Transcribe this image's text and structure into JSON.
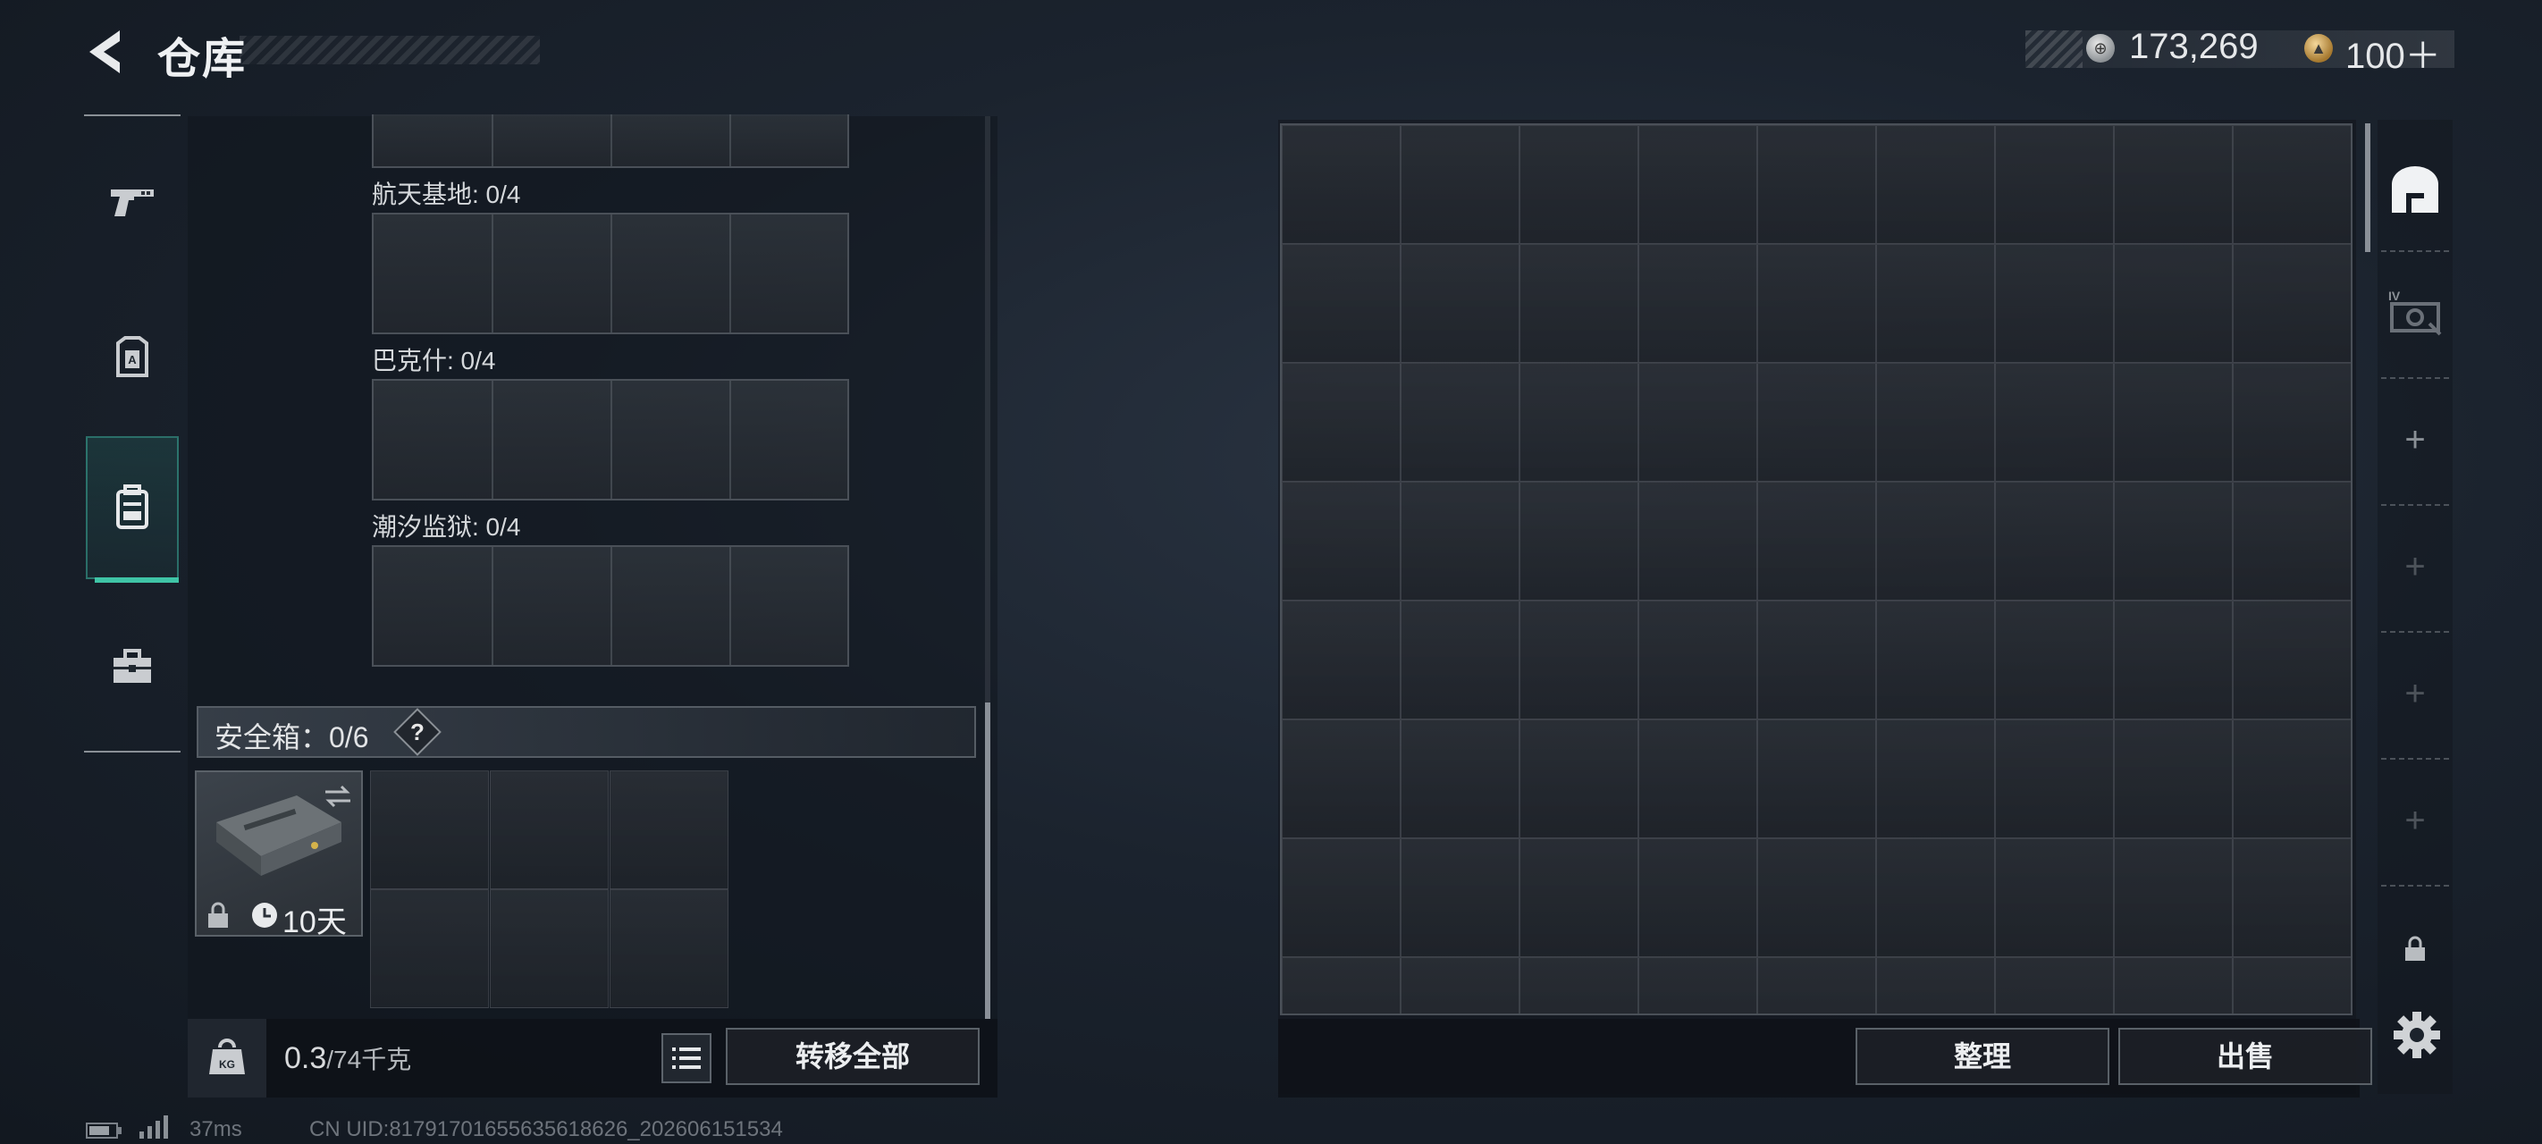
{
  "header": {
    "title": "仓库",
    "currency": [
      {
        "name": "silver-coin",
        "value": "173,269",
        "color": "#b8bcc0"
      },
      {
        "name": "gold-coin",
        "value": "100＋",
        "color": "#d4a24c"
      }
    ]
  },
  "left_rail": {
    "items": [
      {
        "name": "weapons",
        "icon": "pistol-icon",
        "active": false
      },
      {
        "name": "armor",
        "icon": "armor-plate-icon",
        "active": false
      },
      {
        "name": "storage",
        "icon": "backpack-icon",
        "active": true
      },
      {
        "name": "tools",
        "icon": "toolbox-icon",
        "active": false
      }
    ]
  },
  "map_slots": [
    {
      "label": "航天基地: 0/4"
    },
    {
      "label": "巴克什: 0/4"
    },
    {
      "label": "潮汐监狱: 0/4"
    }
  ],
  "safe_box": {
    "label": "安全箱：0/6",
    "help": "?",
    "duration": "10天"
  },
  "weight": {
    "current": "0.3",
    "max": "/74千克",
    "unit_badge": "KG"
  },
  "buttons": {
    "transfer_all": "转移全部",
    "sort": "整理",
    "sell": "出售"
  },
  "footer": {
    "ping": "37ms",
    "uid": "CN UID:8179170165563561862​6_202606151534"
  },
  "accent_color": "#3fc4a6"
}
